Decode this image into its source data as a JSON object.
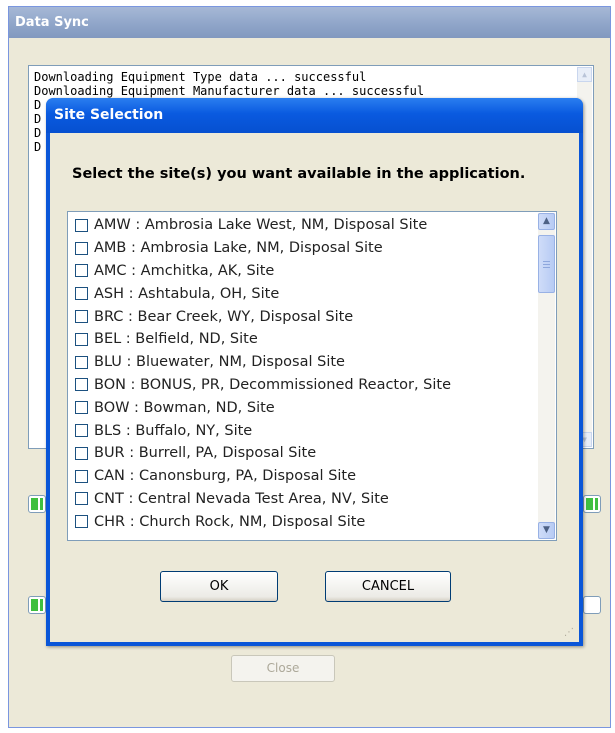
{
  "outer_window": {
    "title": "Data Sync",
    "log_lines": [
      "Downloading Equipment Type data ... successful",
      "Downloading Equipment Manufacturer data ... successful",
      "D",
      "D",
      "D",
      "D"
    ],
    "close_label": "Close"
  },
  "modal": {
    "title": "Site Selection",
    "prompt": "Select the site(s) you want available in the application.",
    "sites": [
      "AMW : Ambrosia Lake West, NM, Disposal Site",
      "AMB : Ambrosia Lake, NM, Disposal Site",
      "AMC : Amchitka, AK, Site",
      "ASH : Ashtabula, OH, Site",
      "BRC : Bear Creek, WY, Disposal Site",
      "BEL : Belfield, ND, Site",
      "BLU : Bluewater, NM, Disposal Site",
      "BON : BONUS, PR, Decommissioned Reactor, Site",
      "BOW : Bowman, ND, Site",
      "BLS : Buffalo, NY, Site",
      "BUR : Burrell, PA, Disposal Site",
      "CAN : Canonsburg, PA, Disposal Site",
      "CNT : Central Nevada Test Area, NV, Site",
      "CHR : Church Rock, NM, Disposal Site"
    ],
    "ok_label": "OK",
    "cancel_label": "CANCEL"
  },
  "colors": {
    "title_blue": "#0a56d8",
    "window_bg": "#ece9d8",
    "progress_green": "#3fbf3f"
  }
}
